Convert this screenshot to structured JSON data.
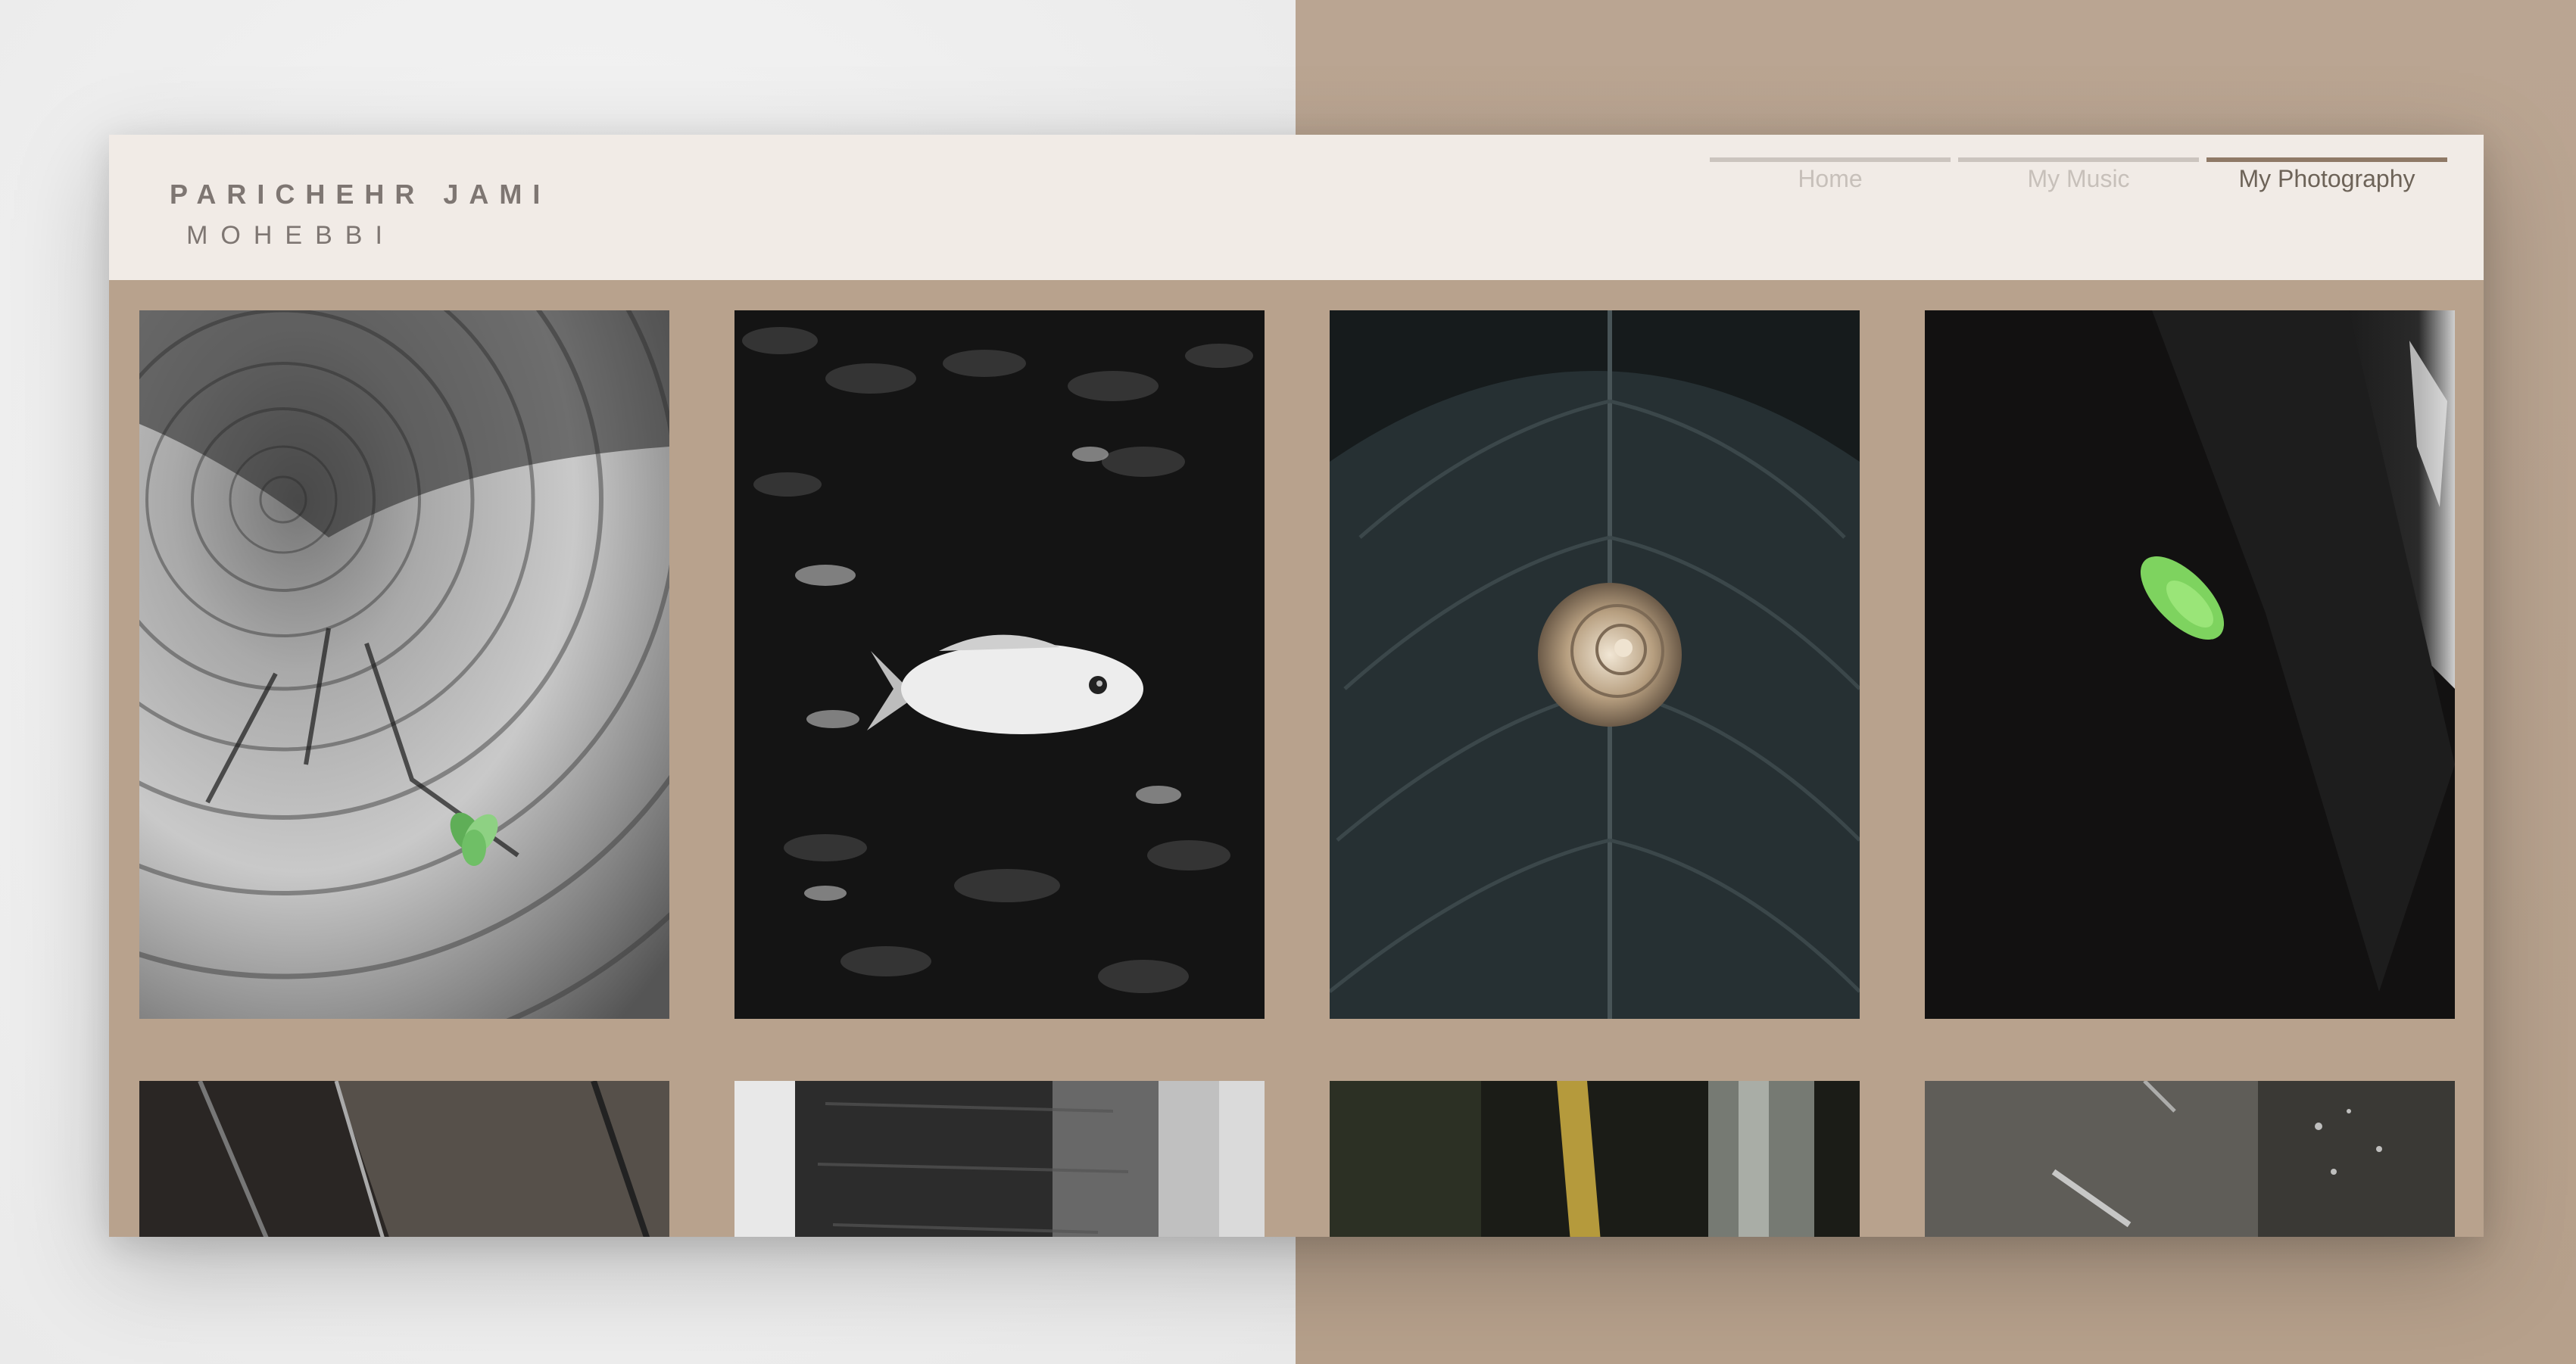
{
  "site": {
    "name_line1": "PARICHEHR JAMI",
    "name_line2": "MOHEBBI"
  },
  "nav": {
    "items": [
      {
        "label": "Home",
        "active": false
      },
      {
        "label": "My Music",
        "active": false
      },
      {
        "label": "My Photography",
        "active": true
      }
    ]
  },
  "gallery": {
    "photos": [
      {
        "subject": "tree-stump-with-sprout"
      },
      {
        "subject": "white-fish-among-dark-fish"
      },
      {
        "subject": "snail-on-dark-leaf"
      },
      {
        "subject": "green-leaf-in-shadow"
      },
      {
        "subject": "dark-plant-stems"
      },
      {
        "subject": "tree-bark-close-up"
      },
      {
        "subject": "dark-foliage-yellow-stem"
      },
      {
        "subject": "grey-wall-with-light"
      }
    ]
  },
  "colors": {
    "header_bg": "#f1ebe6",
    "content_bg": "#b8a28d",
    "active_nav": "#8f7966",
    "inactive_nav": "#cbc4be"
  }
}
